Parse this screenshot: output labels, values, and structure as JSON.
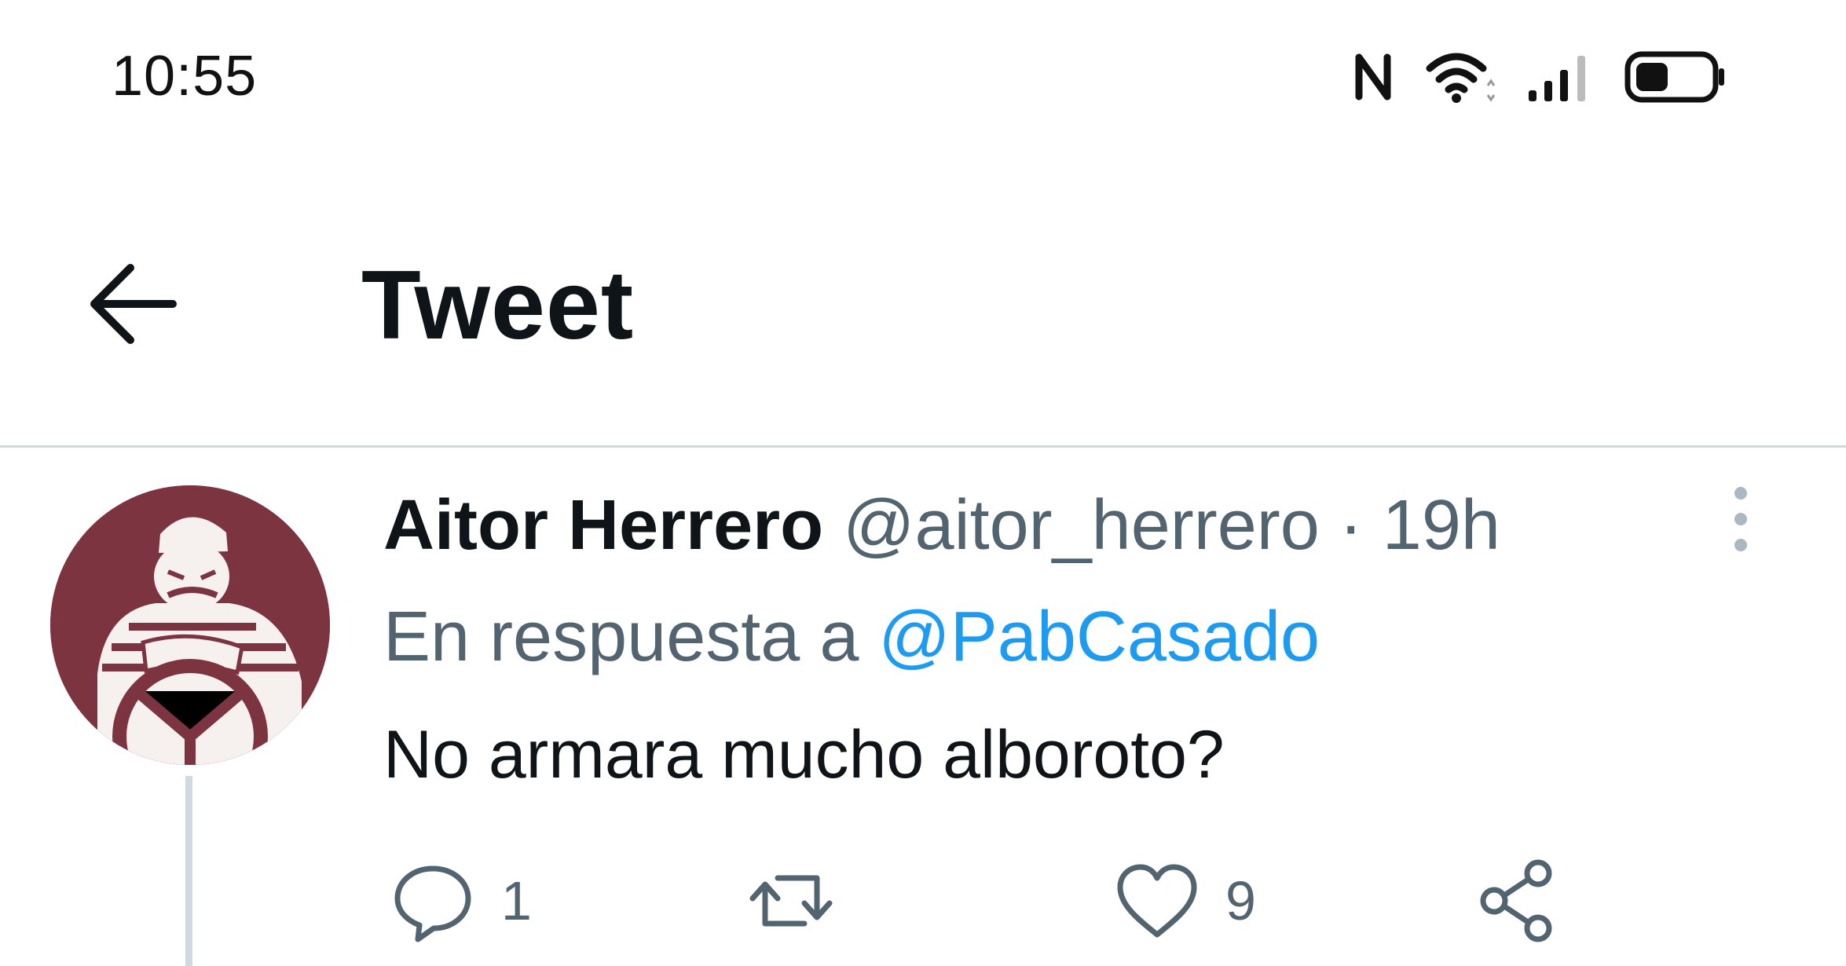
{
  "status_bar": {
    "time": "10:55",
    "icons": [
      "nfc-icon",
      "wifi-icon",
      "signal-icon",
      "battery-icon"
    ],
    "battery_level": 0.4
  },
  "header": {
    "title": "Tweet",
    "back_icon": "back-arrow-icon"
  },
  "tweet": {
    "author_name": "Aitor Herrero",
    "author_handle": "@aitor_herrero",
    "separator": "·",
    "time": "19h",
    "reply_prefix": "En respuesta a",
    "reply_to": "@PabCasado",
    "text": "No armara mucho alboroto?",
    "actions": {
      "reply_count": "1",
      "retweet_count": "",
      "like_count": "9"
    }
  },
  "colors": {
    "link": "#1d9bf0",
    "secondary_text": "#536471",
    "primary_text": "#0f1419",
    "avatar_bg": "#7d3441",
    "divider": "#cfd9de"
  }
}
